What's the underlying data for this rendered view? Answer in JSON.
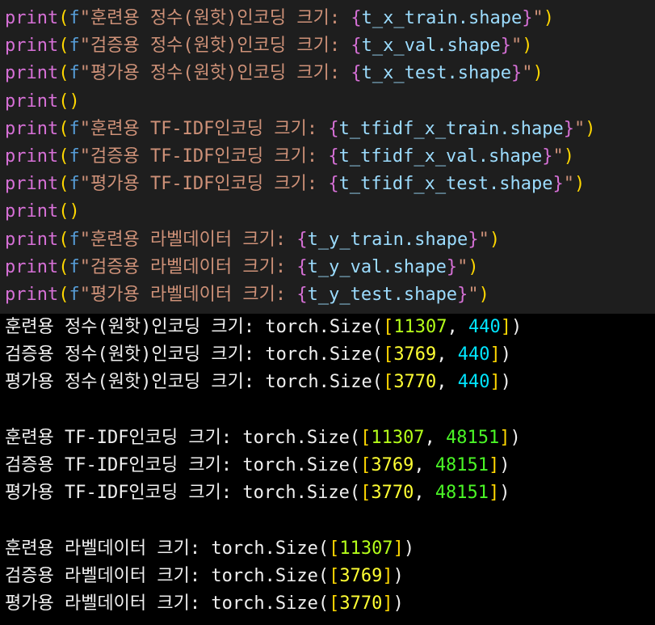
{
  "code_lines": [
    {
      "type": "fprint",
      "text": "훈련용 정수(원핫)인코딩 크기: ",
      "expr": "t_x_train.shape"
    },
    {
      "type": "fprint",
      "text": "검증용 정수(원핫)인코딩 크기: ",
      "expr": "t_x_val.shape"
    },
    {
      "type": "fprint",
      "text": "평가용 정수(원핫)인코딩 크기: ",
      "expr": "t_x_test.shape"
    },
    {
      "type": "empty"
    },
    {
      "type": "fprint",
      "text": "훈련용 TF-IDF인코딩 크기: ",
      "expr": "t_tfidf_x_train.shape"
    },
    {
      "type": "fprint",
      "text": "검증용 TF-IDF인코딩 크기: ",
      "expr": "t_tfidf_x_val.shape"
    },
    {
      "type": "fprint",
      "text": "평가용 TF-IDF인코딩 크기: ",
      "expr": "t_tfidf_x_test.shape"
    },
    {
      "type": "empty"
    },
    {
      "type": "fprint",
      "text": "훈련용 라벨데이터 크기: ",
      "expr": "t_y_train.shape"
    },
    {
      "type": "fprint",
      "text": "검증용 라벨데이터 크기: ",
      "expr": "t_y_val.shape"
    },
    {
      "type": "fprint",
      "text": "평가용 라벨데이터 크기: ",
      "expr": "t_y_test.shape"
    }
  ],
  "code_tokens": {
    "fn": "print",
    "open": "(",
    "close": ")",
    "fprefix": "f",
    "quote": "\"",
    "lbrace": "{",
    "rbrace": "}"
  },
  "output_lines": [
    {
      "prefix": "훈련용 정수(원핫)인코딩 크기: torch.Size(",
      "dims": [
        "11307",
        "440"
      ]
    },
    {
      "prefix": "검증용 정수(원핫)인코딩 크기: torch.Size(",
      "dims": [
        "3769",
        "440"
      ]
    },
    {
      "prefix": "평가용 정수(원핫)인코딩 크기: torch.Size(",
      "dims": [
        "3770",
        "440"
      ]
    },
    {
      "prefix": "",
      "dims": []
    },
    {
      "prefix": "훈련용 TF-IDF인코딩 크기: torch.Size(",
      "dims": [
        "11307",
        "48151"
      ]
    },
    {
      "prefix": "검증용 TF-IDF인코딩 크기: torch.Size(",
      "dims": [
        "3769",
        "48151"
      ]
    },
    {
      "prefix": "평가용 TF-IDF인코딩 크기: torch.Size(",
      "dims": [
        "3770",
        "48151"
      ]
    },
    {
      "prefix": "",
      "dims": []
    },
    {
      "prefix": "훈련용 라벨데이터 크기: torch.Size(",
      "dims": [
        "11307"
      ]
    },
    {
      "prefix": "검증용 라벨데이터 크기: torch.Size(",
      "dims": [
        "3769"
      ]
    },
    {
      "prefix": "평가용 라벨데이터 크기: torch.Size(",
      "dims": [
        "3770"
      ]
    }
  ],
  "colors": {
    "editor_bg": "#1e1e1e",
    "output_bg": "#000000",
    "print_fn": "#d670d6",
    "paren": "#ffd700",
    "f_prefix": "#569cd6",
    "string": "#ce9178",
    "expression": "#9cdcfe",
    "first_dim": [
      "#b5ff1a",
      "#ffff33",
      "#ffff33"
    ],
    "second_dim_a": "#00e5ff",
    "second_dim_b": "#4af626"
  }
}
